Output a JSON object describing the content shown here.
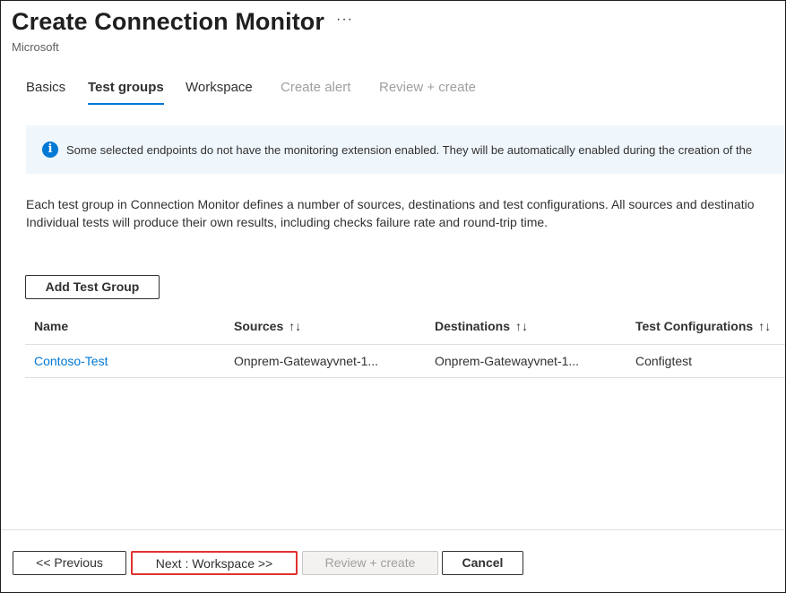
{
  "header": {
    "title": "Create Connection Monitor",
    "more_label": "···",
    "subtitle": "Microsoft"
  },
  "tabs": [
    {
      "label": "Basics",
      "state": "enabled"
    },
    {
      "label": "Test groups",
      "state": "active"
    },
    {
      "label": "Workspace",
      "state": "enabled"
    },
    {
      "label": "Create alert",
      "state": "disabled"
    },
    {
      "label": "Review + create",
      "state": "disabled"
    }
  ],
  "info": {
    "icon": "info-icon",
    "glyph": "i",
    "message": "Some selected endpoints do not have the monitoring extension enabled. They will be automatically enabled during the creation of the"
  },
  "description": {
    "line1": "Each test group in Connection Monitor defines a number of sources, destinations and test configurations. All sources and destinatio",
    "line2": "Individual tests will produce their own results, including checks failure rate and round-trip time."
  },
  "actions": {
    "add_test_group": "Add Test Group"
  },
  "table": {
    "columns": [
      {
        "label": "Name",
        "sortable": false
      },
      {
        "label": "Sources",
        "sortable": true
      },
      {
        "label": "Destinations",
        "sortable": true
      },
      {
        "label": "Test Configurations",
        "sortable": true
      }
    ],
    "sort_glyph": "↑↓",
    "rows": [
      {
        "name": "Contoso-Test",
        "sources": "Onprem-Gatewayvnet-1...",
        "destinations": "Onprem-Gatewayvnet-1...",
        "test_configurations": "Configtest"
      }
    ]
  },
  "footer": {
    "previous": "<< Previous",
    "next": "Next : Workspace >>",
    "review_create": "Review + create",
    "cancel": "Cancel"
  },
  "colors": {
    "accent": "#0078d4",
    "info_background": "#eff6fc",
    "highlight_border": "#e0322f"
  }
}
